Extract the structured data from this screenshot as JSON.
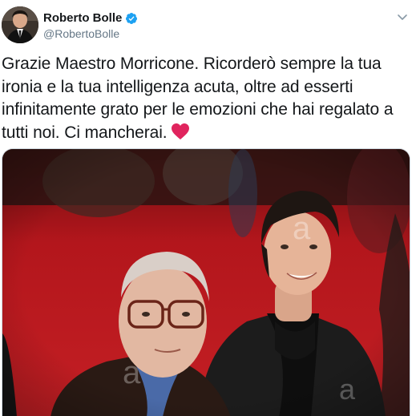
{
  "tweet": {
    "author": {
      "display_name": "Roberto Bolle",
      "handle": "@RobertoBolle",
      "verified": true
    },
    "text": "Grazie Maestro Morricone. Ricorderò sempre la tua ironia e la tua intelligenza acuta, oltre ad esserti infinitamente grato per le emozioni che hai regalato a tutti noi. Ci mancherai.",
    "emoji": "red-heart",
    "media": {
      "watermarks": [
        "a",
        "a",
        "a"
      ]
    }
  },
  "icons": {
    "verified": "verified-badge-icon",
    "more": "chevron-down-icon",
    "heart": "red-heart-icon"
  },
  "colors": {
    "verified_blue": "#1da1f2",
    "heart_red": "#e0245e",
    "secondary_text": "#657786",
    "carpet_red": "#b8161c"
  }
}
